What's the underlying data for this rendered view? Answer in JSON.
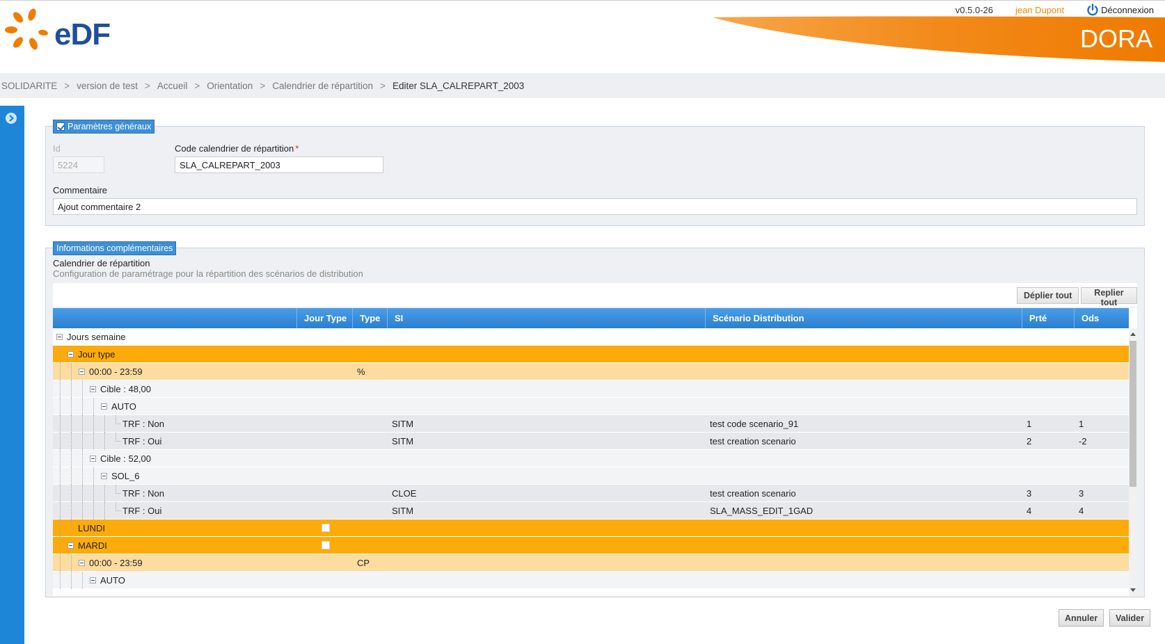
{
  "header": {
    "logo_text": "eDF",
    "app_name": "DORA",
    "version": "v0.5.0-26",
    "user": "jean Dupont",
    "logout_label": "Déconnexion",
    "colors": {
      "brand_blue": "#1f4e9c",
      "brand_orange": "#f08c00",
      "accent_blue": "#1e86d6"
    }
  },
  "breadcrumb": [
    "SOLIDARITE",
    "version de test",
    "Accueil",
    "Orientation",
    "Calendrier de répartition",
    "Editer SLA_CALREPART_2003"
  ],
  "general": {
    "legend": "Paramètres généraux",
    "id_label": "Id",
    "id_value": "5224",
    "code_label": "Code calendrier de répartition",
    "code_required": "*",
    "code_value": "SLA_CALREPART_2003",
    "comment_label": "Commentaire",
    "comment_value": "Ajout commentaire 2"
  },
  "complementary": {
    "legend": "Informations complémentaires",
    "title": "Calendrier de répartition",
    "description": "Configuration de paramétrage pour la répartition des scénarios de distribution",
    "expand_all": "Déplier tout",
    "collapse_all": "Replier tout"
  },
  "grid": {
    "columns": [
      "",
      "Jour Type",
      "Type",
      "SI",
      "Scénario Distribution",
      "Prté",
      "Ods"
    ],
    "rows": [
      {
        "label": "Jours semaine",
        "level": 0,
        "style": "white",
        "expander": true,
        "checkbox": false,
        "type": "",
        "si": "",
        "scenario": "",
        "prte": "",
        "ods": ""
      },
      {
        "label": "Jour type",
        "level": 1,
        "style": "orange",
        "expander": true,
        "checkbox": false,
        "type": "",
        "si": "",
        "scenario": "",
        "prte": "",
        "ods": ""
      },
      {
        "label": "00:00 - 23:59",
        "level": 2,
        "style": "peach",
        "expander": true,
        "checkbox": false,
        "type": "%",
        "si": "",
        "scenario": "",
        "prte": "",
        "ods": ""
      },
      {
        "label": "Cible : 48,00",
        "level": 3,
        "style": "light",
        "expander": true,
        "checkbox": false,
        "type": "",
        "si": "",
        "scenario": "",
        "prte": "",
        "ods": ""
      },
      {
        "label": "AUTO",
        "level": 4,
        "style": "light",
        "expander": true,
        "checkbox": false,
        "type": "",
        "si": "",
        "scenario": "",
        "prte": "",
        "ods": ""
      },
      {
        "label": "TRF : Non",
        "level": 5,
        "style": "gray",
        "expander": false,
        "checkbox": false,
        "type": "",
        "si": "SITM",
        "scenario": "test code scenario_91",
        "prte": "1",
        "ods": "1"
      },
      {
        "label": "TRF : Oui",
        "level": 5,
        "style": "gray",
        "expander": false,
        "checkbox": false,
        "type": "",
        "si": "SITM",
        "scenario": "test creation scenario",
        "prte": "2",
        "ods": "-2"
      },
      {
        "label": "Cible : 52,00",
        "level": 3,
        "style": "light",
        "expander": true,
        "checkbox": false,
        "type": "",
        "si": "",
        "scenario": "",
        "prte": "",
        "ods": ""
      },
      {
        "label": "SOL_6",
        "level": 4,
        "style": "light",
        "expander": true,
        "checkbox": false,
        "type": "",
        "si": "",
        "scenario": "",
        "prte": "",
        "ods": ""
      },
      {
        "label": "TRF : Non",
        "level": 5,
        "style": "gray",
        "expander": false,
        "checkbox": false,
        "type": "",
        "si": "CLOE",
        "scenario": "test creation scenario",
        "prte": "3",
        "ods": "3"
      },
      {
        "label": "TRF : Oui",
        "level": 5,
        "style": "gray",
        "expander": false,
        "checkbox": false,
        "type": "",
        "si": "SITM",
        "scenario": "SLA_MASS_EDIT_1GAD",
        "prte": "4",
        "ods": "4"
      },
      {
        "label": "LUNDI",
        "level": 1,
        "style": "orange",
        "expander": false,
        "checkbox": true,
        "type": "",
        "si": "",
        "scenario": "",
        "prte": "",
        "ods": ""
      },
      {
        "label": "MARDI",
        "level": 1,
        "style": "orange",
        "expander": true,
        "checkbox": true,
        "type": "",
        "si": "",
        "scenario": "",
        "prte": "",
        "ods": ""
      },
      {
        "label": "00:00 - 23:59",
        "level": 2,
        "style": "peach",
        "expander": true,
        "checkbox": false,
        "type": "CP",
        "si": "",
        "scenario": "",
        "prte": "",
        "ods": ""
      },
      {
        "label": "AUTO",
        "level": 3,
        "style": "light",
        "expander": true,
        "checkbox": false,
        "type": "",
        "si": "",
        "scenario": "",
        "prte": "",
        "ods": ""
      }
    ]
  },
  "footer": {
    "cancel": "Annuler",
    "validate": "Valider"
  }
}
